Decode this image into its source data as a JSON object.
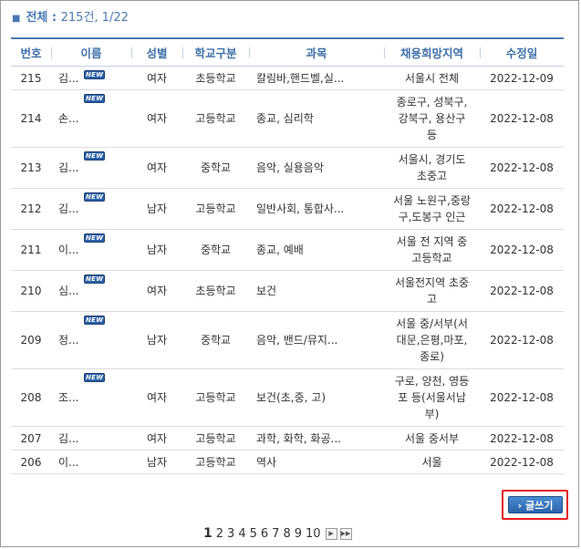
{
  "summary": {
    "label": "전체 :",
    "total": "215건, 1/22"
  },
  "columns": [
    "번호",
    "이름",
    "성별",
    "학교구분",
    "과목",
    "채용희망지역",
    "수정일"
  ],
  "new_badge": "NEW",
  "rows": [
    {
      "no": "215",
      "name": "김...",
      "new": true,
      "gender": "여자",
      "school": "초등학교",
      "subject": "칼림바,핸드벨,실...",
      "region": [
        "서울시 전체"
      ],
      "date": "2022-12-09"
    },
    {
      "no": "214",
      "name": "손...",
      "new": true,
      "gender": "여자",
      "school": "고등학교",
      "subject": "종교, 심리학",
      "region": [
        "종로구, 성북구,",
        "강북구, 용산구",
        "등"
      ],
      "date": "2022-12-08"
    },
    {
      "no": "213",
      "name": "김...",
      "new": true,
      "gender": "여자",
      "school": "중학교",
      "subject": "음악, 실용음악",
      "region": [
        "서울시, 경기도",
        "초중고"
      ],
      "date": "2022-12-08"
    },
    {
      "no": "212",
      "name": "김...",
      "new": true,
      "gender": "남자",
      "school": "고등학교",
      "subject": "일반사회, 통합사...",
      "region": [
        "서울 노원구,중랑",
        "구,도봉구 인근"
      ],
      "date": "2022-12-08"
    },
    {
      "no": "211",
      "name": "이...",
      "new": true,
      "gender": "남자",
      "school": "중학교",
      "subject": "종교, 예배",
      "region": [
        "서울 전 지역 중",
        "고등학교"
      ],
      "date": "2022-12-08"
    },
    {
      "no": "210",
      "name": "심...",
      "new": true,
      "gender": "여자",
      "school": "초등학교",
      "subject": "보건",
      "region": [
        "서울전지역 초중",
        "고"
      ],
      "date": "2022-12-08"
    },
    {
      "no": "209",
      "name": "정...",
      "new": true,
      "gender": "남자",
      "school": "중학교",
      "subject": "음악, 밴드/뮤지...",
      "region": [
        "서울 중/서부(서",
        "대문,은평,마포,",
        "종로)"
      ],
      "date": "2022-12-08"
    },
    {
      "no": "208",
      "name": "조...",
      "new": true,
      "gender": "여자",
      "school": "고등학교",
      "subject": "보건(초,중, 고)",
      "region": [
        "구로, 양천, 영등",
        "포 등(서울서남",
        "부)"
      ],
      "date": "2022-12-08"
    },
    {
      "no": "207",
      "name": "김...",
      "new": false,
      "gender": "여자",
      "school": "고등학교",
      "subject": "과학, 화학, 화공...",
      "region": [
        "서울 중서부"
      ],
      "date": "2022-12-08"
    },
    {
      "no": "206",
      "name": "이...",
      "new": false,
      "gender": "남자",
      "school": "고등학교",
      "subject": "역사",
      "region": [
        "서울"
      ],
      "date": "2022-12-08"
    }
  ],
  "write_button": "› 글쓰기",
  "pages": [
    "1",
    "2",
    "3",
    "4",
    "5",
    "6",
    "7",
    "8",
    "9",
    "10"
  ],
  "current_page": "1",
  "pager_icons": [
    "next-page-icon",
    "last-page-icon"
  ]
}
